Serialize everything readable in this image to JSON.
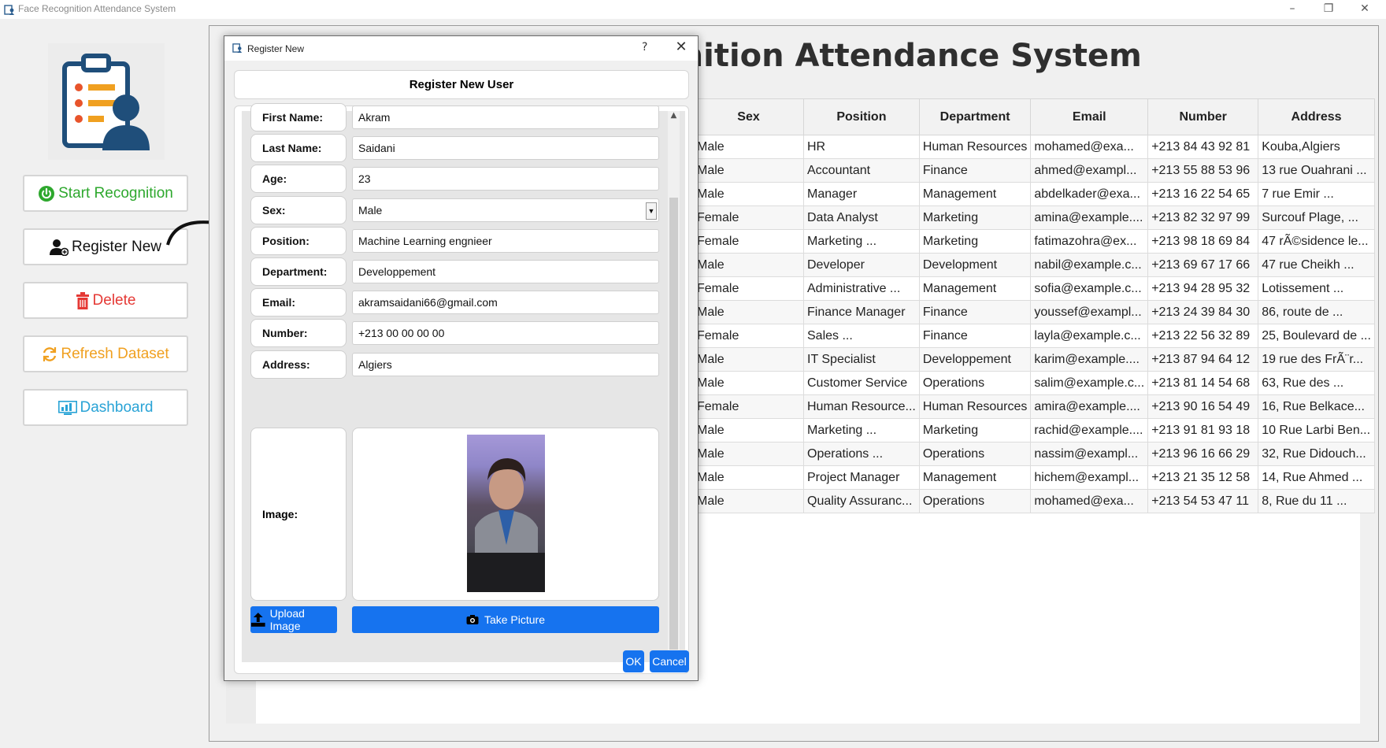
{
  "window": {
    "title": "Face Recognition Attendance System"
  },
  "main": {
    "title": "Face Recognition Attendance System"
  },
  "sidebar": {
    "buttons": [
      {
        "label": "Start Recognition",
        "color": "#2ea82e"
      },
      {
        "label": "Register New",
        "color": "#111111"
      },
      {
        "label": "Delete",
        "color": "#e53935"
      },
      {
        "label": "Refresh Dataset",
        "color": "#f0a020"
      },
      {
        "label": "Dashboard",
        "color": "#29a3d6"
      }
    ]
  },
  "table": {
    "columns": [
      "Sex",
      "Position",
      "Department",
      "Email",
      "Number",
      "Address"
    ],
    "rows": [
      [
        "Male",
        "HR",
        "Human Resources",
        "mohamed@exa...",
        "+213 84 43 92 81",
        "Kouba,Algiers"
      ],
      [
        "Male",
        "Accountant",
        "Finance",
        "ahmed@exampl...",
        "+213 55 88 53 96",
        "13 rue Ouahrani ..."
      ],
      [
        "Male",
        "Manager",
        "Management",
        "abdelkader@exa...",
        "+213 16 22 54 65",
        "7 rue Emir ..."
      ],
      [
        "Female",
        "Data Analyst",
        "Marketing",
        "amina@example....",
        "+213 82 32 97 99",
        "Surcouf Plage, ..."
      ],
      [
        "Female",
        "Marketing ...",
        "Marketing",
        "fatimazohra@ex...",
        "+213 98 18 69 84",
        "47 rÃ©sidence le..."
      ],
      [
        "Male",
        "Developer",
        "Development",
        "nabil@example.c...",
        "+213 69 67 17 66",
        "47 rue Cheikh ..."
      ],
      [
        "Female",
        "Administrative ...",
        "Management",
        "sofia@example.c...",
        "+213 94 28 95 32",
        "Lotissement ..."
      ],
      [
        "Male",
        "Finance Manager",
        "Finance",
        "youssef@exampl...",
        "+213 24 39 84 30",
        "86, route de ..."
      ],
      [
        "Female",
        "Sales ...",
        "Finance",
        "layla@example.c...",
        "+213 22 56 32 89",
        "25, Boulevard de ..."
      ],
      [
        "Male",
        "IT Specialist",
        "Developpement",
        "karim@example....",
        "+213 87 94 64 12",
        "19 rue des FrÃ¨r..."
      ],
      [
        "Male",
        "Customer Service",
        "Operations",
        "salim@example.c...",
        "+213 81 14 54 68",
        "63, Rue des ..."
      ],
      [
        "Female",
        "Human Resource...",
        "Human Resources",
        "amira@example....",
        "+213 90 16 54 49",
        "16, Rue Belkace..."
      ],
      [
        "Male",
        "Marketing ...",
        "Marketing",
        "rachid@example....",
        "+213 91 81 93 18",
        "10 Rue Larbi Ben..."
      ],
      [
        "Male",
        "Operations ...",
        "Operations",
        "nassim@exampl...",
        "+213 96 16 66 29",
        "32, Rue Didouch..."
      ],
      [
        "Male",
        "Project Manager",
        "Management",
        "hichem@exampl...",
        "+213 21 35 12 58",
        "14, Rue Ahmed ..."
      ],
      [
        "Male",
        "Quality Assuranc...",
        "Operations",
        "mohamed@exa...",
        "+213 54 53 47 11",
        "8, Rue du 11 ..."
      ]
    ]
  },
  "dialog": {
    "title": "Register New",
    "help": "?",
    "close": "✕",
    "header": "Register New User",
    "fields": [
      {
        "label": "First Name:",
        "value": "Akram"
      },
      {
        "label": "Last Name:",
        "value": "Saidani"
      },
      {
        "label": "Age:",
        "value": "23"
      },
      {
        "label": "Sex:",
        "value": "Male",
        "type": "select"
      },
      {
        "label": "Position:",
        "value": "Machine Learning engnieer"
      },
      {
        "label": "Department:",
        "value": "Developpement"
      },
      {
        "label": "Email:",
        "value": "akramsaidani66@gmail.com"
      },
      {
        "label": "Number:",
        "value": "+213 00 00 00 00"
      },
      {
        "label": "Address:",
        "value": "Algiers"
      }
    ],
    "image_label": "Image:",
    "upload_label": "Upload Image",
    "take_picture_label": "Take Picture",
    "ok_label": "OK",
    "cancel_label": "Cancel"
  }
}
